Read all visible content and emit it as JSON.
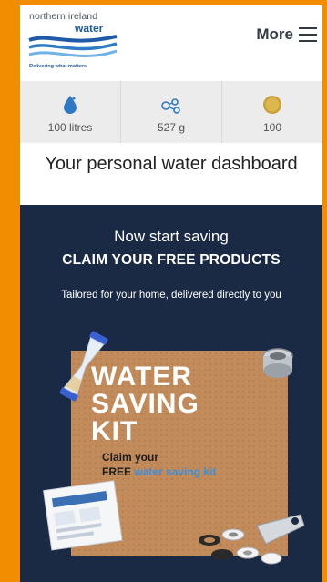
{
  "header": {
    "logo": {
      "line1": "northern ireland",
      "line2": "water",
      "tagline": "Delivering what matters"
    },
    "more_label": "More"
  },
  "stats": [
    {
      "icon": "water-drop-icon",
      "value": "100 litres"
    },
    {
      "icon": "co2-molecule-icon",
      "value": "527 g"
    },
    {
      "icon": "coin-icon",
      "value": "100"
    }
  ],
  "title": "Your personal water dashboard",
  "promo": {
    "subtitle": "Now start saving",
    "headline": "CLAIM YOUR FREE PRODUCTS",
    "description": "Tailored for your home, delivered directly to you",
    "kit": {
      "title": "WATER\nSAVING\nKIT",
      "claim": "Claim your",
      "free": "FREE",
      "link": "water saving kit"
    }
  },
  "colors": {
    "border": "#F28C00",
    "promo_bg": "#1a2a45",
    "brand_blue": "#1f5aa6",
    "link_blue": "#3a8fe0"
  }
}
